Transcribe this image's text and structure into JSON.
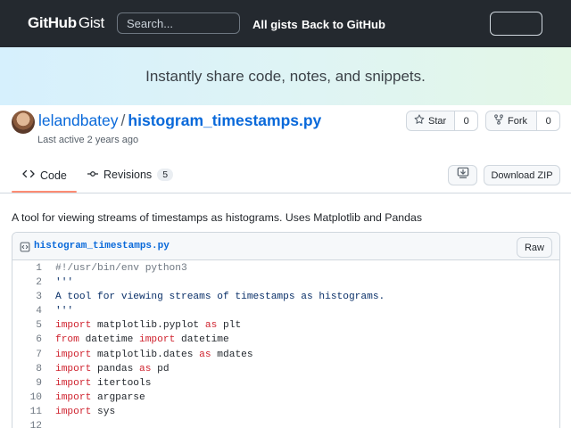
{
  "header": {
    "logo_main": "GitHub",
    "logo_sub": "Gist",
    "search_placeholder": "Search...",
    "nav_all_gists": "All gists",
    "nav_back": "Back to GitHub"
  },
  "banner": {
    "text": "Instantly share code, notes, and snippets."
  },
  "gist": {
    "owner": "lelandbatey",
    "separator": "/",
    "name": "histogram_timestamps.py",
    "last_active": "Last active 2 years ago",
    "star_label": "Star",
    "star_count": "0",
    "fork_label": "Fork",
    "fork_count": "0",
    "description": "A tool for viewing streams of timestamps as histograms. Uses Matplotlib and Pandas"
  },
  "tabs": {
    "code_label": "Code",
    "revisions_label": "Revisions",
    "revisions_count": "5",
    "download_zip": "Download ZIP"
  },
  "file": {
    "filename": "histogram_timestamps.py",
    "raw_label": "Raw",
    "lines": [
      {
        "n": "1",
        "tokens": [
          {
            "t": "#!/usr/bin/env python3",
            "c": "cmt"
          }
        ]
      },
      {
        "n": "2",
        "tokens": [
          {
            "t": "'''",
            "c": "str"
          }
        ]
      },
      {
        "n": "3",
        "tokens": [
          {
            "t": "A tool for viewing streams of timestamps as histograms.",
            "c": "str"
          }
        ]
      },
      {
        "n": "4",
        "tokens": [
          {
            "t": "'''",
            "c": "str"
          }
        ]
      },
      {
        "n": "5",
        "tokens": [
          {
            "t": "import",
            "c": "kw"
          },
          {
            "t": " matplotlib.pyplot ",
            "c": ""
          },
          {
            "t": "as",
            "c": "kw"
          },
          {
            "t": " plt",
            "c": ""
          }
        ]
      },
      {
        "n": "6",
        "tokens": [
          {
            "t": "from",
            "c": "kw"
          },
          {
            "t": " datetime ",
            "c": ""
          },
          {
            "t": "import",
            "c": "kw"
          },
          {
            "t": " datetime",
            "c": ""
          }
        ]
      },
      {
        "n": "7",
        "tokens": [
          {
            "t": "import",
            "c": "kw"
          },
          {
            "t": " matplotlib.dates ",
            "c": ""
          },
          {
            "t": "as",
            "c": "kw"
          },
          {
            "t": " mdates",
            "c": ""
          }
        ]
      },
      {
        "n": "8",
        "tokens": [
          {
            "t": "import",
            "c": "kw"
          },
          {
            "t": " pandas ",
            "c": ""
          },
          {
            "t": "as",
            "c": "kw"
          },
          {
            "t": " pd",
            "c": ""
          }
        ]
      },
      {
        "n": "9",
        "tokens": [
          {
            "t": "import",
            "c": "kw"
          },
          {
            "t": " itertools",
            "c": ""
          }
        ]
      },
      {
        "n": "10",
        "tokens": [
          {
            "t": "import",
            "c": "kw"
          },
          {
            "t": " argparse",
            "c": ""
          }
        ]
      },
      {
        "n": "11",
        "tokens": [
          {
            "t": "import",
            "c": "kw"
          },
          {
            "t": " sys",
            "c": ""
          }
        ]
      },
      {
        "n": "12",
        "tokens": []
      }
    ]
  },
  "colors": {
    "header_bg": "#24292f",
    "link": "#0969da",
    "keyword": "#cf222e",
    "string": "#0a3069",
    "tab_underline": "#fd8c73"
  },
  "icons": [
    "star-icon",
    "fork-icon",
    "code-icon",
    "revisions-icon",
    "download-icon",
    "file-code-icon",
    "avatar"
  ]
}
